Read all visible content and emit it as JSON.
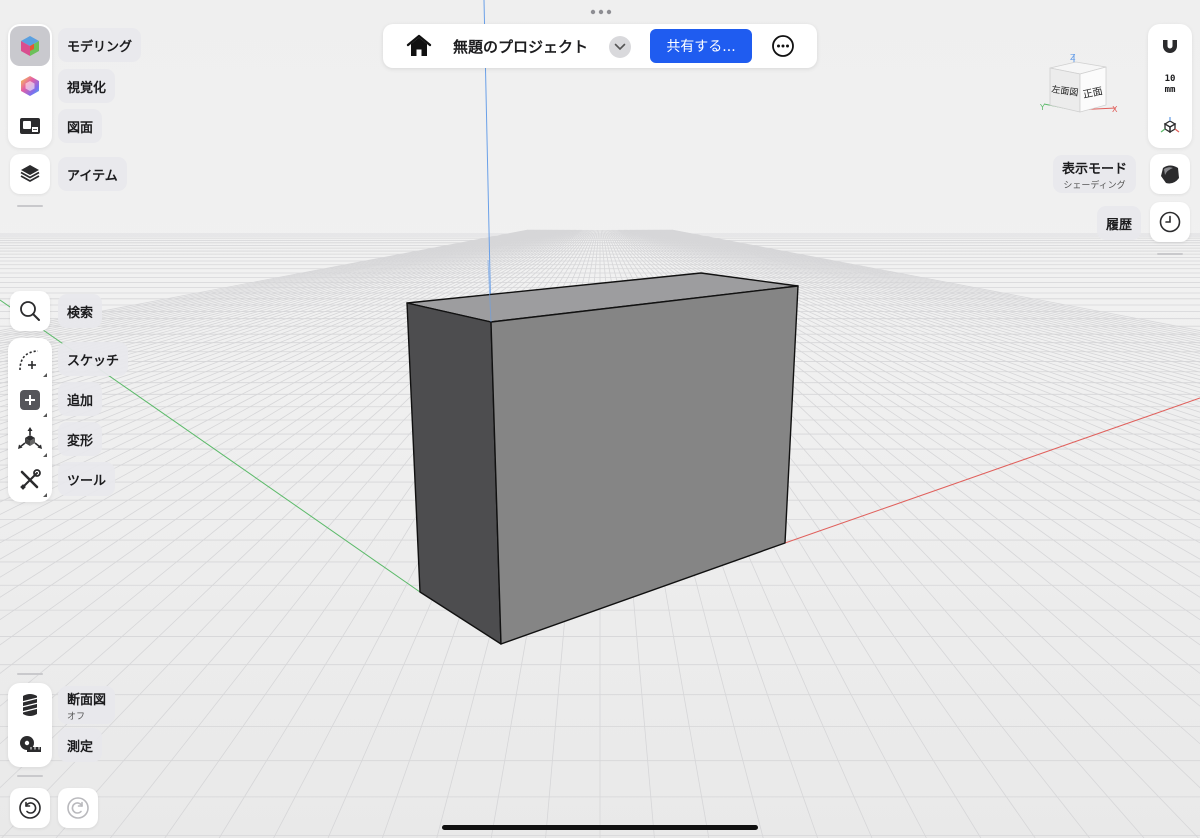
{
  "top_bar": {
    "project_title": "無題のプロジェクト",
    "share_label": "共有する..."
  },
  "left_panel": {
    "workspaces": [
      {
        "name": "modeling",
        "label": "モデリング",
        "icon": "modeling-cube-icon",
        "active": true
      },
      {
        "name": "visualize",
        "label": "視覚化",
        "icon": "visualize-hexagon-icon"
      },
      {
        "name": "drawing",
        "label": "図面",
        "icon": "drawing-sheet-icon"
      }
    ],
    "items_label": "アイテム",
    "search_label": "検索",
    "tools": [
      {
        "name": "sketch",
        "label": "スケッチ",
        "icon": "sketch-arc-icon"
      },
      {
        "name": "add",
        "label": "追加",
        "icon": "add-square-icon"
      },
      {
        "name": "transform",
        "label": "変形",
        "icon": "transform-axes-icon"
      },
      {
        "name": "tools",
        "label": "ツール",
        "icon": "wrench-screwdriver-icon"
      }
    ],
    "section": {
      "label": "断面図",
      "state": "オフ"
    },
    "measure_label": "測定"
  },
  "right_panel": {
    "unit_value": "10",
    "unit_name": "mm",
    "display_mode": {
      "label": "表示モード",
      "value": "シェーディング"
    },
    "history_label": "履歴"
  },
  "view_cube": {
    "left_face": "左面図",
    "front_face": "正面",
    "axes": {
      "x": "X",
      "y": "Y",
      "z": "Z"
    }
  },
  "colors": {
    "accent": "#1f5cf0",
    "x_axis": "#e0605c",
    "y_axis": "#5cba6a",
    "z_axis": "#6aa0e8",
    "box_front": "#858585",
    "box_side": "#4d4d4f",
    "box_top": "#9d9d9f"
  }
}
